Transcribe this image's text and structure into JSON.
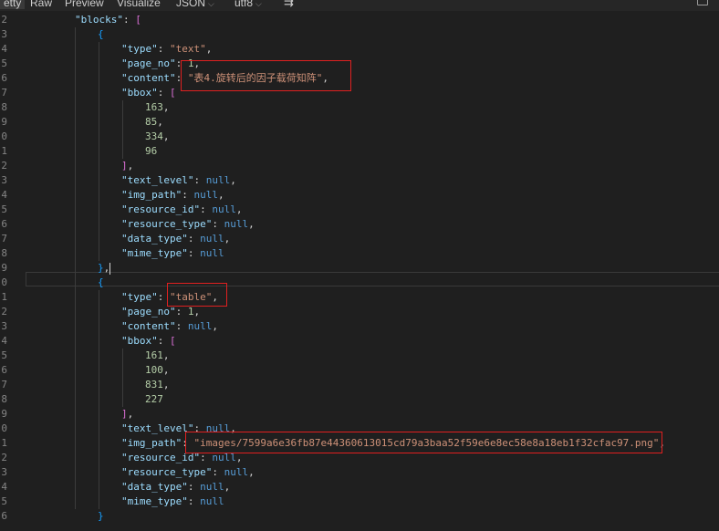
{
  "toolbar": {
    "tabs": [
      {
        "label": "etty",
        "active": true
      },
      {
        "label": "Raw",
        "active": false
      },
      {
        "label": "Preview",
        "active": false
      },
      {
        "label": "Visualize",
        "active": false
      }
    ],
    "format_select": "JSON",
    "encoding_select": "utf8",
    "wrap_icon": "word-wrap-icon",
    "right_icon": "window-icon"
  },
  "editor": {
    "line_numbers": [
      "2",
      "3",
      "4",
      "5",
      "6",
      "7",
      "8",
      "9",
      "0",
      "1",
      "2",
      "3",
      "4",
      "5",
      "6",
      "7",
      "8",
      "9",
      "0",
      "1",
      "2",
      "3",
      "4",
      "5",
      "6",
      "7",
      "8",
      "9",
      "0",
      "1",
      "2",
      "3",
      "4",
      "5",
      "6"
    ],
    "current_line_index": 17,
    "lines": [
      {
        "indent": 0,
        "tokens": [
          {
            "t": "key",
            "v": "\"blocks\""
          },
          {
            "t": "punc",
            "v": ": "
          },
          {
            "t": "br1",
            "v": "["
          }
        ]
      },
      {
        "indent": 1,
        "tokens": [
          {
            "t": "br2",
            "v": "{"
          }
        ]
      },
      {
        "indent": 2,
        "tokens": [
          {
            "t": "key",
            "v": "\"type\""
          },
          {
            "t": "punc",
            "v": ": "
          },
          {
            "t": "str",
            "v": "\"text\""
          },
          {
            "t": "punc",
            "v": ","
          }
        ]
      },
      {
        "indent": 2,
        "tokens": [
          {
            "t": "key",
            "v": "\"page_no\""
          },
          {
            "t": "punc",
            "v": ": "
          },
          {
            "t": "num",
            "v": "1"
          },
          {
            "t": "punc",
            "v": ","
          }
        ]
      },
      {
        "indent": 2,
        "tokens": [
          {
            "t": "key",
            "v": "\"content\""
          },
          {
            "t": "punc",
            "v": ": "
          },
          {
            "t": "str",
            "v": "\"表4.旋转后的因子载荷知阵\""
          },
          {
            "t": "punc",
            "v": ","
          }
        ]
      },
      {
        "indent": 2,
        "tokens": [
          {
            "t": "key",
            "v": "\"bbox\""
          },
          {
            "t": "punc",
            "v": ": "
          },
          {
            "t": "br1",
            "v": "["
          }
        ]
      },
      {
        "indent": 3,
        "tokens": [
          {
            "t": "num",
            "v": "163"
          },
          {
            "t": "punc",
            "v": ","
          }
        ]
      },
      {
        "indent": 3,
        "tokens": [
          {
            "t": "num",
            "v": "85"
          },
          {
            "t": "punc",
            "v": ","
          }
        ]
      },
      {
        "indent": 3,
        "tokens": [
          {
            "t": "num",
            "v": "334"
          },
          {
            "t": "punc",
            "v": ","
          }
        ]
      },
      {
        "indent": 3,
        "tokens": [
          {
            "t": "num",
            "v": "96"
          }
        ]
      },
      {
        "indent": 2,
        "tokens": [
          {
            "t": "br1",
            "v": "]"
          },
          {
            "t": "punc",
            "v": ","
          }
        ]
      },
      {
        "indent": 2,
        "tokens": [
          {
            "t": "key",
            "v": "\"text_level\""
          },
          {
            "t": "punc",
            "v": ": "
          },
          {
            "t": "kw",
            "v": "null"
          },
          {
            "t": "punc",
            "v": ","
          }
        ]
      },
      {
        "indent": 2,
        "tokens": [
          {
            "t": "key",
            "v": "\"img_path\""
          },
          {
            "t": "punc",
            "v": ": "
          },
          {
            "t": "kw",
            "v": "null"
          },
          {
            "t": "punc",
            "v": ","
          }
        ]
      },
      {
        "indent": 2,
        "tokens": [
          {
            "t": "key",
            "v": "\"resource_id\""
          },
          {
            "t": "punc",
            "v": ": "
          },
          {
            "t": "kw",
            "v": "null"
          },
          {
            "t": "punc",
            "v": ","
          }
        ]
      },
      {
        "indent": 2,
        "tokens": [
          {
            "t": "key",
            "v": "\"resource_type\""
          },
          {
            "t": "punc",
            "v": ": "
          },
          {
            "t": "kw",
            "v": "null"
          },
          {
            "t": "punc",
            "v": ","
          }
        ]
      },
      {
        "indent": 2,
        "tokens": [
          {
            "t": "key",
            "v": "\"data_type\""
          },
          {
            "t": "punc",
            "v": ": "
          },
          {
            "t": "kw",
            "v": "null"
          },
          {
            "t": "punc",
            "v": ","
          }
        ]
      },
      {
        "indent": 2,
        "tokens": [
          {
            "t": "key",
            "v": "\"mime_type\""
          },
          {
            "t": "punc",
            "v": ": "
          },
          {
            "t": "kw",
            "v": "null"
          }
        ]
      },
      {
        "indent": 1,
        "tokens": [
          {
            "t": "br2",
            "v": "}"
          },
          {
            "t": "punc",
            "v": ","
          }
        ],
        "cursor": true
      },
      {
        "indent": 1,
        "tokens": [
          {
            "t": "br2",
            "v": "{"
          }
        ]
      },
      {
        "indent": 2,
        "tokens": [
          {
            "t": "key",
            "v": "\"type\""
          },
          {
            "t": "punc",
            "v": ": "
          },
          {
            "t": "str",
            "v": "\"table\""
          },
          {
            "t": "punc",
            "v": ","
          }
        ]
      },
      {
        "indent": 2,
        "tokens": [
          {
            "t": "key",
            "v": "\"page_no\""
          },
          {
            "t": "punc",
            "v": ": "
          },
          {
            "t": "num",
            "v": "1"
          },
          {
            "t": "punc",
            "v": ","
          }
        ]
      },
      {
        "indent": 2,
        "tokens": [
          {
            "t": "key",
            "v": "\"content\""
          },
          {
            "t": "punc",
            "v": ": "
          },
          {
            "t": "kw",
            "v": "null"
          },
          {
            "t": "punc",
            "v": ","
          }
        ]
      },
      {
        "indent": 2,
        "tokens": [
          {
            "t": "key",
            "v": "\"bbox\""
          },
          {
            "t": "punc",
            "v": ": "
          },
          {
            "t": "br1",
            "v": "["
          }
        ]
      },
      {
        "indent": 3,
        "tokens": [
          {
            "t": "num",
            "v": "161"
          },
          {
            "t": "punc",
            "v": ","
          }
        ]
      },
      {
        "indent": 3,
        "tokens": [
          {
            "t": "num",
            "v": "100"
          },
          {
            "t": "punc",
            "v": ","
          }
        ]
      },
      {
        "indent": 3,
        "tokens": [
          {
            "t": "num",
            "v": "831"
          },
          {
            "t": "punc",
            "v": ","
          }
        ]
      },
      {
        "indent": 3,
        "tokens": [
          {
            "t": "num",
            "v": "227"
          }
        ]
      },
      {
        "indent": 2,
        "tokens": [
          {
            "t": "br1",
            "v": "]"
          },
          {
            "t": "punc",
            "v": ","
          }
        ]
      },
      {
        "indent": 2,
        "tokens": [
          {
            "t": "key",
            "v": "\"text_level\""
          },
          {
            "t": "punc",
            "v": ": "
          },
          {
            "t": "kw",
            "v": "null"
          },
          {
            "t": "punc",
            "v": ","
          }
        ]
      },
      {
        "indent": 2,
        "tokens": [
          {
            "t": "key",
            "v": "\"img_path\""
          },
          {
            "t": "punc",
            "v": ": "
          },
          {
            "t": "str",
            "v": "\"images/7599a6e36fb87e44360613015cd79a3baa52f59e6e8ec58e8a18eb1f32cfac97.png\""
          },
          {
            "t": "punc",
            "v": ","
          }
        ]
      },
      {
        "indent": 2,
        "tokens": [
          {
            "t": "key",
            "v": "\"resource_id\""
          },
          {
            "t": "punc",
            "v": ": "
          },
          {
            "t": "kw",
            "v": "null"
          },
          {
            "t": "punc",
            "v": ","
          }
        ]
      },
      {
        "indent": 2,
        "tokens": [
          {
            "t": "key",
            "v": "\"resource_type\""
          },
          {
            "t": "punc",
            "v": ": "
          },
          {
            "t": "kw",
            "v": "null"
          },
          {
            "t": "punc",
            "v": ","
          }
        ]
      },
      {
        "indent": 2,
        "tokens": [
          {
            "t": "key",
            "v": "\"data_type\""
          },
          {
            "t": "punc",
            "v": ": "
          },
          {
            "t": "kw",
            "v": "null"
          },
          {
            "t": "punc",
            "v": ","
          }
        ]
      },
      {
        "indent": 2,
        "tokens": [
          {
            "t": "key",
            "v": "\"mime_type\""
          },
          {
            "t": "punc",
            "v": ": "
          },
          {
            "t": "kw",
            "v": "null"
          }
        ]
      },
      {
        "indent": 1,
        "tokens": [
          {
            "t": "br2",
            "v": "}"
          }
        ]
      }
    ]
  },
  "annotations": [
    {
      "label": "content-highlight",
      "color": "#e02020"
    },
    {
      "label": "type-table-highlight",
      "color": "#e02020"
    },
    {
      "label": "img-path-highlight",
      "color": "#e02020"
    }
  ]
}
